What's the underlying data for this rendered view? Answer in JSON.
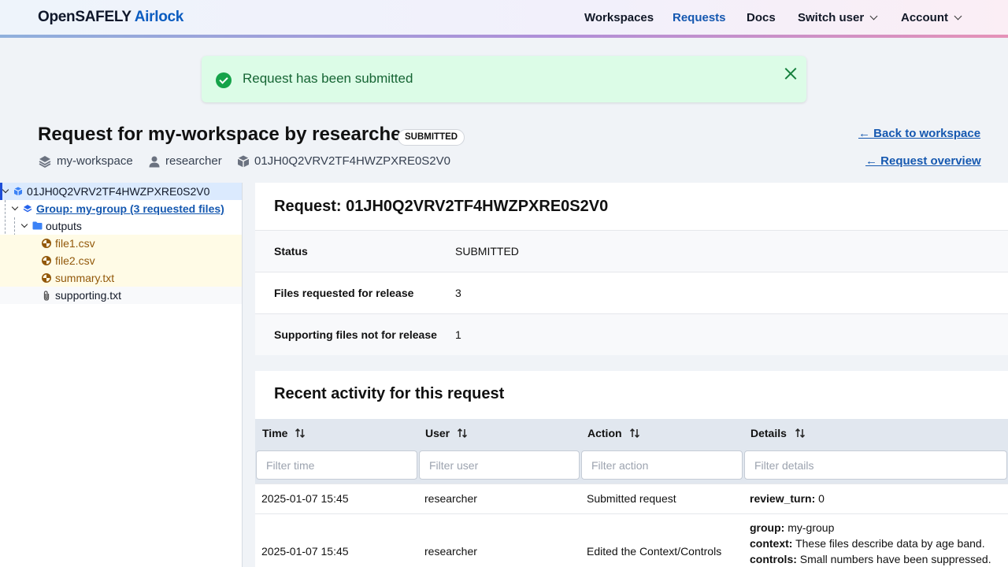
{
  "brand": {
    "part1": "OpenSAFELY",
    "part2": "Airlock"
  },
  "nav": {
    "workspaces": "Workspaces",
    "requests": "Requests",
    "docs": "Docs",
    "switch_user": "Switch user",
    "account": "Account"
  },
  "flash": {
    "message": "Request has been submitted"
  },
  "page": {
    "title": "Request for my-workspace by researcher",
    "status": "SUBMITTED",
    "workspace": "my-workspace",
    "user": "researcher",
    "request_id": "01JH0Q2VRV2TF4HWZPXRE0S2V0",
    "back_to_workspace": "← Back to workspace",
    "request_overview": "← Request overview"
  },
  "tree": {
    "root": "01JH0Q2VRV2TF4HWZPXRE0S2V0",
    "group": "Group: my-group (3 requested files)",
    "folder": "outputs",
    "files": [
      "file1.csv",
      "file2.csv",
      "summary.txt"
    ],
    "supporting": "supporting.txt"
  },
  "summary": {
    "title": "Request: 01JH0Q2VRV2TF4HWZPXRE0S2V0",
    "rows": [
      {
        "key": "Status",
        "value": "SUBMITTED"
      },
      {
        "key": "Files requested for release",
        "value": "3"
      },
      {
        "key": "Supporting files not for release",
        "value": "1"
      }
    ]
  },
  "activity": {
    "title": "Recent activity for this request",
    "columns": [
      "Time",
      "User",
      "Action",
      "Details"
    ],
    "filters": [
      "Filter time",
      "Filter user",
      "Filter action",
      "Filter details"
    ],
    "rows": [
      {
        "time": "2025-01-07 15:45",
        "user": "researcher",
        "action": "Submitted request",
        "details": [
          {
            "k": "review_turn:",
            "v": "0"
          }
        ]
      },
      {
        "time": "2025-01-07 15:45",
        "user": "researcher",
        "action": "Edited the Context/Controls",
        "details": [
          {
            "k": "group:",
            "v": "my-group"
          },
          {
            "k": "context:",
            "v": "These files describe data by age band."
          },
          {
            "k": "controls:",
            "v": "Small numbers have been suppressed."
          }
        ]
      }
    ]
  },
  "colors": {
    "accent": "#1558b0",
    "success_bg": "#dcfce7",
    "success_icon": "#16a34a",
    "requested_file": "#92580a"
  }
}
